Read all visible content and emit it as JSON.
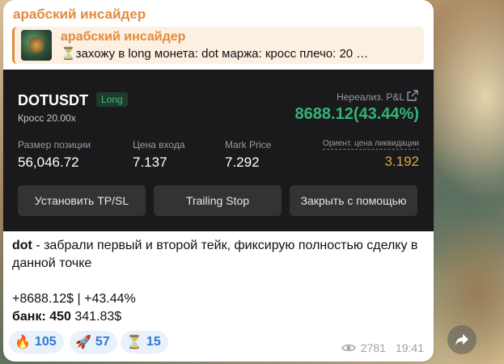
{
  "message": {
    "sender": "арабский инсайдер",
    "reply": {
      "title": "арабский инсайдер",
      "text": "⏳захожу в long  монета: dot маржа: кросс плечо: 20 …"
    },
    "position_card": {
      "pair": "DOTUSDT",
      "side_badge": "Long",
      "margin_mode": "Кросс 20.00x",
      "pnl_label": "Нереализ. P&L",
      "pnl_value": "8688.12(43.44%)",
      "stats": [
        {
          "label": "Размер позиции",
          "value": "56,046.72"
        },
        {
          "label": "Цена входа",
          "value": "7.137"
        },
        {
          "label": "Mark Price",
          "value": "7.292"
        },
        {
          "label": "Ориент. цена ликвидации",
          "value": "3.192"
        }
      ],
      "buttons": [
        "Установить TP/SL",
        "Trailing Stop",
        "Закрыть с помощью"
      ],
      "colors": {
        "pnl": "#32b477",
        "liquidation": "#e2a23a",
        "badge": "#3fbf7f"
      }
    },
    "text": {
      "coin": "dot",
      "line1_rest": " - забрали первый и второй тейк, фиксирую полностью сделку в данной точке",
      "result": "+8688.12$ | +43.44%",
      "bank_label": "банк: 450",
      "bank_value": " 341.83$"
    },
    "reactions": [
      {
        "emoji": "🔥",
        "icon": "fire-icon",
        "count": "105"
      },
      {
        "emoji": "🚀",
        "icon": "rocket-icon",
        "count": "57"
      },
      {
        "emoji": "⏳",
        "icon": "hourglass-icon",
        "count": "15"
      }
    ],
    "views": "2781",
    "time": "19:41"
  }
}
